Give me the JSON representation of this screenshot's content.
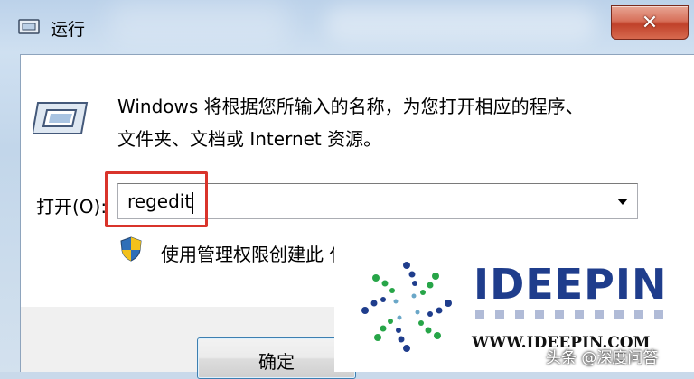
{
  "window": {
    "title": "运行",
    "close_symbol": "✕",
    "title_icon": "run-icon"
  },
  "dialog": {
    "description_line1": "Windows 将根据您所输入的名称，为您打开相应的程序、",
    "description_line2": "文件夹、文档或 Internet 资源。",
    "open_label": "打开(O):",
    "input_value": "regedit",
    "admin_note": "使用管理权限创建此 任务。",
    "ok_label": "确定",
    "icon": "run-dialog-icon",
    "shield_icon": "uac-shield-icon"
  },
  "annotation": {
    "highlight_color": "#d9342b"
  },
  "watermark": {
    "brand": "IDEEPIN",
    "url": "WWW.IDEEPIN.COM",
    "source": "头条 @深度问答",
    "brand_color": "#1f3d8c"
  }
}
